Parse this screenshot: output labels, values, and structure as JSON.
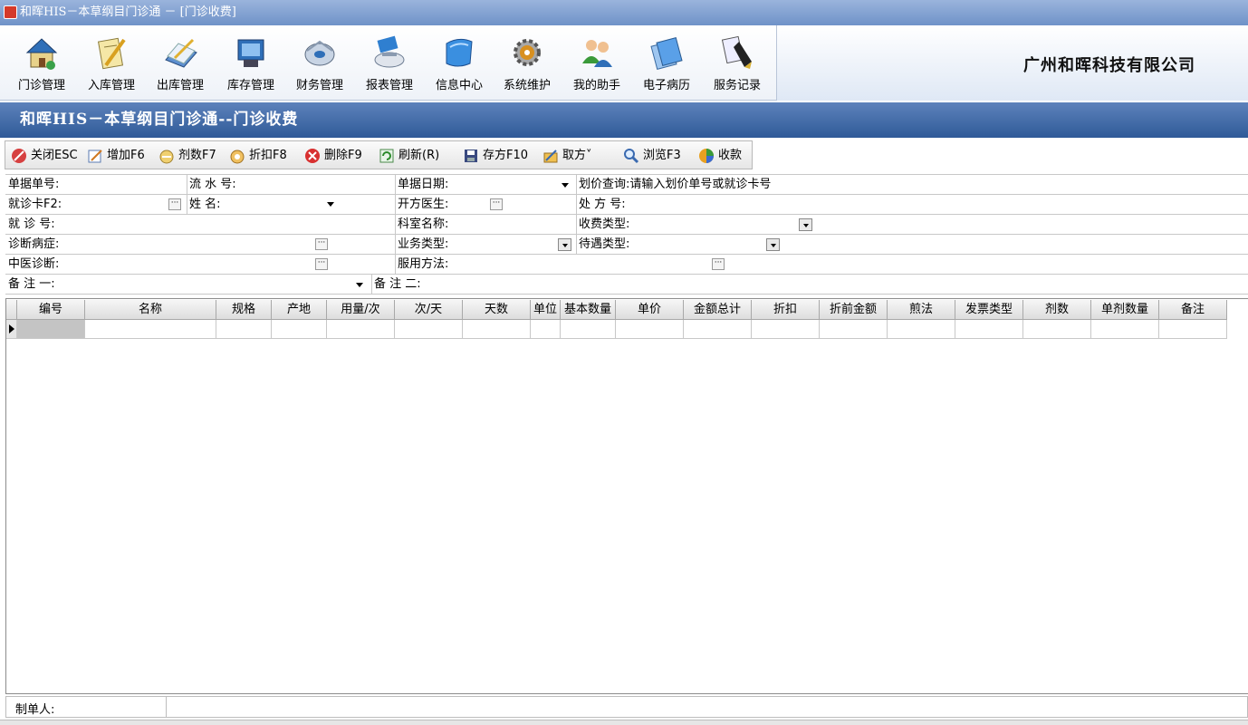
{
  "window": {
    "title": "和晖HIS－本草纲目门诊通 － [门诊收费]"
  },
  "toolbar": {
    "items": [
      {
        "label": "门诊管理",
        "icon": "house-icon"
      },
      {
        "label": "入库管理",
        "icon": "notepad-pencil-icon"
      },
      {
        "label": "出库管理",
        "icon": "book-pen-icon"
      },
      {
        "label": "库存管理",
        "icon": "monitor-box-icon"
      },
      {
        "label": "财务管理",
        "icon": "disc-icon"
      },
      {
        "label": "报表管理",
        "icon": "printer-icon"
      },
      {
        "label": "信息中心",
        "icon": "folder-icon"
      },
      {
        "label": "系统维护",
        "icon": "gear-icon"
      },
      {
        "label": "我的助手",
        "icon": "users-icon"
      },
      {
        "label": "电子病历",
        "icon": "documents-icon"
      },
      {
        "label": "服务记录",
        "icon": "fountain-pen-icon"
      }
    ]
  },
  "company": {
    "name": "广州和晖科技有限公司"
  },
  "banner": {
    "title": "和晖HIS－本草纲目门诊通--门诊收费"
  },
  "actions": {
    "items": [
      {
        "label": "关闭ESC",
        "icon": "close-circle-icon"
      },
      {
        "label": "增加F6",
        "icon": "add-note-icon"
      },
      {
        "label": "剂数F7",
        "icon": "dose-icon"
      },
      {
        "label": "折扣F8",
        "icon": "discount-icon"
      },
      {
        "label": "删除F9",
        "icon": "delete-icon"
      },
      {
        "label": "刷新(R)",
        "icon": "refresh-icon"
      },
      {
        "label": "存方F10",
        "icon": "save-icon"
      },
      {
        "label": "取方˅",
        "icon": "fetch-prescription-icon"
      },
      {
        "label": "浏览F3",
        "icon": "magnifier-icon"
      },
      {
        "label": "收款",
        "icon": "payment-icon"
      }
    ]
  },
  "form": {
    "doc_no": "单据单号:",
    "serial_no": "流 水 号:",
    "doc_date": "单据日期:",
    "price_query_label": "划价查询:",
    "price_query_placeholder": "请输入划价单号或就诊卡号",
    "visit_card": "就诊卡F2:",
    "patient_name": "姓      名:",
    "doctor": "开方医生:",
    "prescription_no": "处 方 号:",
    "visit_no": "就 诊 号:",
    "department": "科室名称:",
    "fee_type": "收费类型:",
    "diagnosis": "诊断病症:",
    "business_type": "业务类型:",
    "treatment_type": "待遇类型:",
    "tcm_diagnosis": "中医诊断:",
    "usage": "服用方法:",
    "remark1": "备 注 一:",
    "remark2": "备 注 二:"
  },
  "grid": {
    "columns": [
      "编号",
      "名称",
      "规格",
      "产地",
      "用量/次",
      "次/天",
      "天数",
      "单位",
      "基本数量",
      "单价",
      "金额总计",
      "折扣",
      "折前金额",
      "煎法",
      "发票类型",
      "剂数",
      "单剂数量",
      "备注"
    ]
  },
  "footer": {
    "maker_label": "制单人:"
  }
}
